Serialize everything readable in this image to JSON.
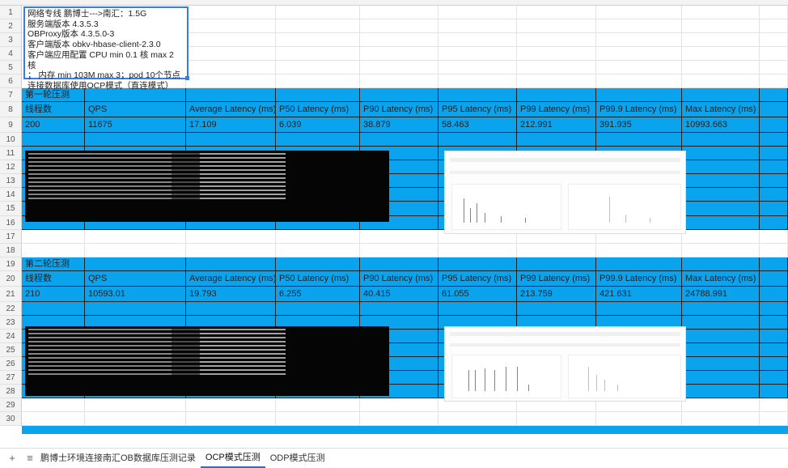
{
  "row_numbers": [
    "1",
    "2",
    "3",
    "4",
    "5",
    "6",
    "7",
    "8",
    "9",
    "10",
    "11",
    "12",
    "13",
    "14",
    "15",
    "16",
    "17",
    "18",
    "19",
    "20",
    "21",
    "22",
    "23",
    "24",
    "25",
    "26",
    "27",
    "28",
    "29",
    "30"
  ],
  "textbox_lines": [
    "网络专线 鹏博士--->南汇：1.5G",
    "服务端版本 4.3.5.3",
    "OBProxy版本 4.3.5.0-3",
    "客户端版本 obkv-hbase-client-2.3.0",
    "客户端应用配置 CPU min 0.1 核   max 2 核",
    "；  内存  min 103M  max 3；pod  10个节点",
    "连接数据库使用OCP模式（直连模式）"
  ],
  "headers": [
    "线程数",
    "QPS",
    "Average Latency (ms)",
    "P50 Latency (ms)",
    "P90 Latency (ms)",
    "P95 Latency (ms)",
    "P99 Latency (ms)",
    "P99.9 Latency (ms)",
    "Max Latency (ms)"
  ],
  "round1": {
    "title": "第一轮压测",
    "values": [
      "200",
      "11675",
      "17.109",
      "6.039",
      "38.879",
      "58.463",
      "212.991",
      "391.935",
      "10993.663"
    ]
  },
  "round2": {
    "title": "第二轮压测",
    "values": [
      "210",
      "10593.01",
      "19.793",
      "6.255",
      "40.415",
      "61.055",
      "213.759",
      "421.631",
      "24788.991"
    ]
  },
  "tabs": {
    "add": "+",
    "list": "≡",
    "items": [
      "鹏博士环境连接南汇OB数据库压测记录",
      "OCP模式压测",
      "ODP模式压测"
    ],
    "active_index": 1
  },
  "colors": {
    "blue": "#0aa3ee",
    "selection": "#3b7ddd"
  }
}
